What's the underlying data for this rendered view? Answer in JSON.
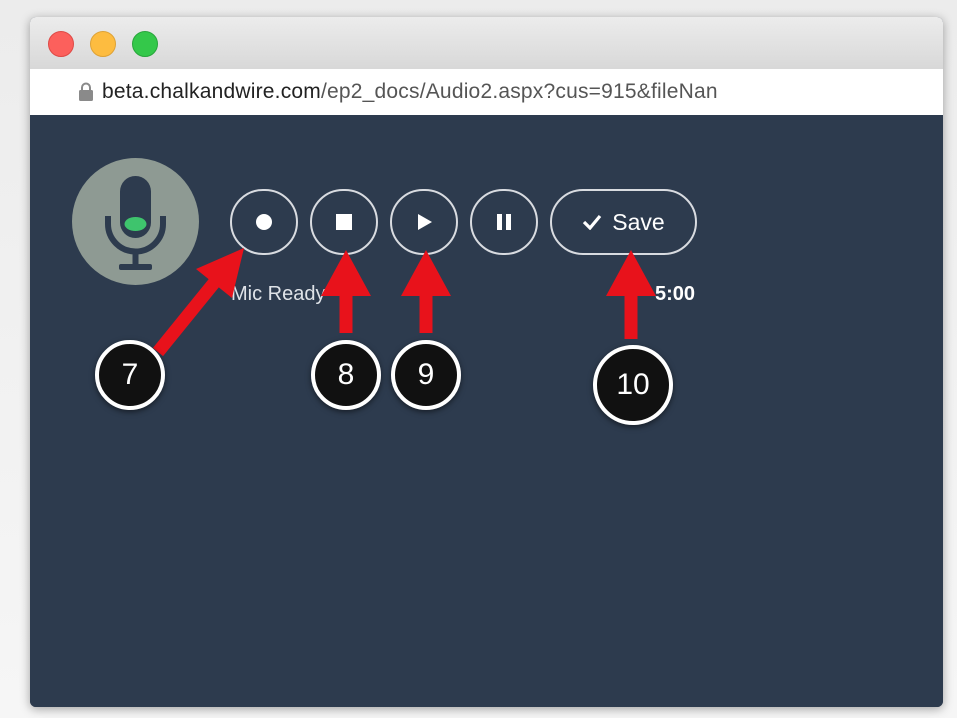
{
  "browser": {
    "url_host": "beta.chalkandwire.com",
    "url_path": "/ep2_docs/Audio2.aspx?cus=915&fileNan"
  },
  "recorder": {
    "save_label": "Save",
    "status": "Mic Ready",
    "timer": "5:00"
  },
  "callouts": [
    "7",
    "8",
    "9",
    "10"
  ],
  "colors": {
    "background": "#2d3b4e",
    "arrow": "#e8121b",
    "mic_circle": "#8e9a93",
    "mic_indicator": "#3ec46d"
  },
  "icons": [
    "lock-icon",
    "microphone-icon",
    "record-icon",
    "stop-icon",
    "play-icon",
    "pause-icon",
    "check-icon"
  ]
}
